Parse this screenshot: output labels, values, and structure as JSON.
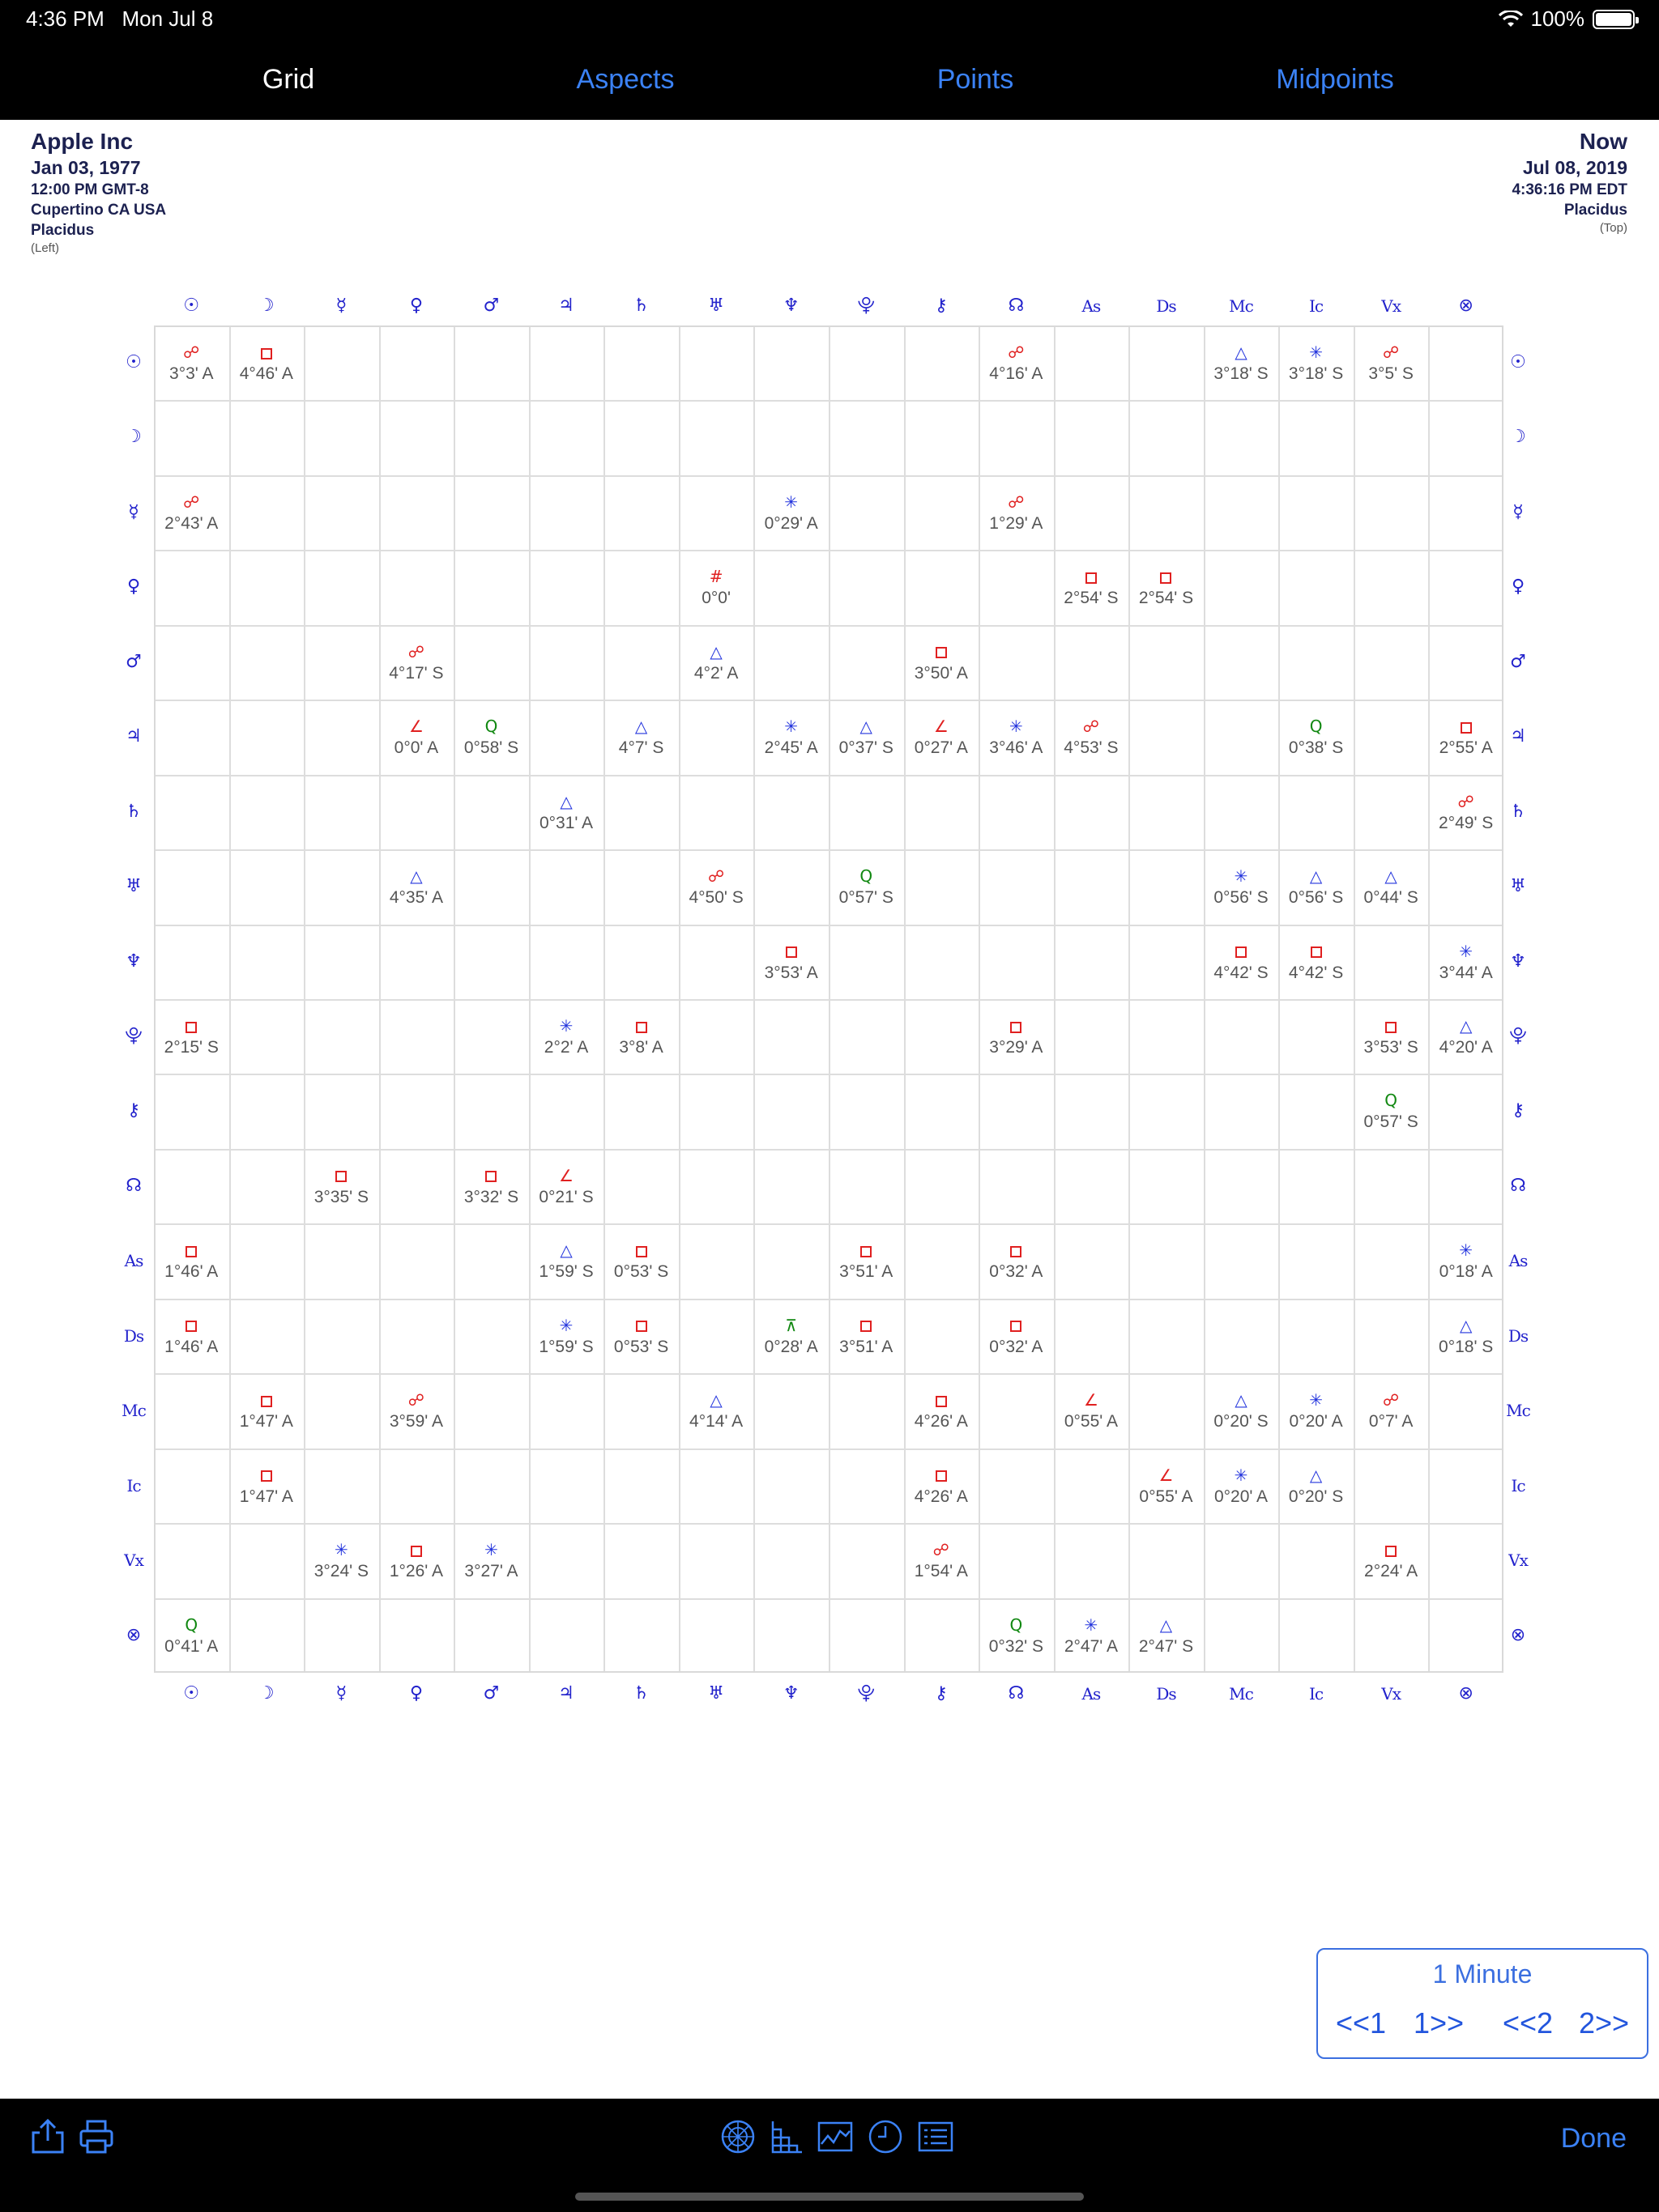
{
  "status": {
    "time": "4:36 PM",
    "date": "Mon Jul 8",
    "battery": "100%"
  },
  "tabs": [
    {
      "label": "Grid",
      "active": true
    },
    {
      "label": "Aspects",
      "active": false
    },
    {
      "label": "Points",
      "active": false
    },
    {
      "label": "Midpoints",
      "active": false
    }
  ],
  "left_chart": {
    "name": "Apple Inc",
    "date": "Jan 03, 1977",
    "time": "12:00 PM GMT-8",
    "place": "Cupertino CA USA",
    "house": "Placidus",
    "position": "(Left)"
  },
  "right_chart": {
    "name": "Now",
    "date": "Jul 08, 2019",
    "time": "4:36:16 PM EDT",
    "house": "Placidus",
    "position": "(Top)"
  },
  "points": [
    "☉",
    "☽",
    "☿",
    "♀",
    "♂",
    "♃",
    "♄",
    "♅",
    "♆",
    "⯓",
    "⚷",
    "☊",
    "As",
    "Ds",
    "Mc",
    "Ic",
    "Vx",
    "⊗"
  ],
  "point_names": [
    "sun",
    "moon",
    "mercury",
    "venus",
    "mars",
    "jupiter",
    "saturn",
    "uranus",
    "neptune",
    "pluto",
    "chiron",
    "node",
    "ascendant",
    "descendant",
    "midheaven",
    "imum-coeli",
    "vertex",
    "part-of-fortune"
  ],
  "aspect_styles": {
    "opp": {
      "glyph": "☍",
      "color": "#e02020"
    },
    "sq": {
      "glyph": "□",
      "color": "#e02020"
    },
    "tri": {
      "glyph": "△",
      "color": "#2233dd"
    },
    "sex": {
      "glyph": "✳",
      "color": "#2233dd"
    },
    "semi": {
      "glyph": "∠",
      "color": "#e02020"
    },
    "par": {
      "glyph": "#",
      "color": "#e02020"
    },
    "q": {
      "glyph": "Q",
      "color": "#118811"
    },
    "inc": {
      "glyph": "⊼",
      "color": "#118811"
    }
  },
  "aspects": [
    {
      "r": 0,
      "c": 0,
      "t": "opp",
      "o": "3°3' A"
    },
    {
      "r": 0,
      "c": 1,
      "t": "sq",
      "o": "4°46' A"
    },
    {
      "r": 0,
      "c": 11,
      "t": "opp",
      "o": "4°16' A"
    },
    {
      "r": 0,
      "c": 14,
      "t": "tri",
      "o": "3°18' S"
    },
    {
      "r": 0,
      "c": 15,
      "t": "sex",
      "o": "3°18' S"
    },
    {
      "r": 0,
      "c": 16,
      "t": "opp",
      "o": "3°5' S"
    },
    {
      "r": 2,
      "c": 0,
      "t": "opp",
      "o": "2°43' A"
    },
    {
      "r": 2,
      "c": 8,
      "t": "sex",
      "o": "0°29' A"
    },
    {
      "r": 2,
      "c": 11,
      "t": "opp",
      "o": "1°29' A"
    },
    {
      "r": 3,
      "c": 7,
      "t": "par",
      "o": "0°0'"
    },
    {
      "r": 3,
      "c": 12,
      "t": "sq",
      "o": "2°54' S"
    },
    {
      "r": 3,
      "c": 13,
      "t": "sq",
      "o": "2°54' S"
    },
    {
      "r": 4,
      "c": 3,
      "t": "opp",
      "o": "4°17' S"
    },
    {
      "r": 4,
      "c": 7,
      "t": "tri",
      "o": "4°2' A"
    },
    {
      "r": 4,
      "c": 10,
      "t": "sq",
      "o": "3°50' A"
    },
    {
      "r": 5,
      "c": 3,
      "t": "semi",
      "o": "0°0' A"
    },
    {
      "r": 5,
      "c": 4,
      "t": "q",
      "o": "0°58' S"
    },
    {
      "r": 5,
      "c": 6,
      "t": "tri",
      "o": "4°7' S"
    },
    {
      "r": 5,
      "c": 8,
      "t": "sex",
      "o": "2°45' A"
    },
    {
      "r": 5,
      "c": 9,
      "t": "tri",
      "o": "0°37' S"
    },
    {
      "r": 5,
      "c": 10,
      "t": "semi",
      "o": "0°27' A"
    },
    {
      "r": 5,
      "c": 11,
      "t": "sex",
      "o": "3°46' A"
    },
    {
      "r": 5,
      "c": 12,
      "t": "opp",
      "o": "4°53' S"
    },
    {
      "r": 5,
      "c": 15,
      "t": "q",
      "o": "0°38' S"
    },
    {
      "r": 5,
      "c": 17,
      "t": "sq",
      "o": "2°55' A"
    },
    {
      "r": 6,
      "c": 5,
      "t": "tri",
      "o": "0°31' A"
    },
    {
      "r": 6,
      "c": 17,
      "t": "opp",
      "o": "2°49' S"
    },
    {
      "r": 7,
      "c": 3,
      "t": "tri",
      "o": "4°35' A"
    },
    {
      "r": 7,
      "c": 7,
      "t": "opp",
      "o": "4°50' S"
    },
    {
      "r": 7,
      "c": 9,
      "t": "q",
      "o": "0°57' S"
    },
    {
      "r": 7,
      "c": 14,
      "t": "sex",
      "o": "0°56' S"
    },
    {
      "r": 7,
      "c": 15,
      "t": "tri",
      "o": "0°56' S"
    },
    {
      "r": 7,
      "c": 16,
      "t": "tri",
      "o": "0°44' S"
    },
    {
      "r": 8,
      "c": 8,
      "t": "sq",
      "o": "3°53' A"
    },
    {
      "r": 8,
      "c": 14,
      "t": "sq",
      "o": "4°42' S"
    },
    {
      "r": 8,
      "c": 15,
      "t": "sq",
      "o": "4°42' S"
    },
    {
      "r": 8,
      "c": 17,
      "t": "sex",
      "o": "3°44' A"
    },
    {
      "r": 9,
      "c": 0,
      "t": "sq",
      "o": "2°15' S"
    },
    {
      "r": 9,
      "c": 5,
      "t": "sex",
      "o": "2°2' A"
    },
    {
      "r": 9,
      "c": 6,
      "t": "sq",
      "o": "3°8' A"
    },
    {
      "r": 9,
      "c": 11,
      "t": "sq",
      "o": "3°29' A"
    },
    {
      "r": 9,
      "c": 16,
      "t": "sq",
      "o": "3°53' S"
    },
    {
      "r": 9,
      "c": 17,
      "t": "tri",
      "o": "4°20' A"
    },
    {
      "r": 10,
      "c": 16,
      "t": "q",
      "o": "0°57' S"
    },
    {
      "r": 11,
      "c": 2,
      "t": "sq",
      "o": "3°35' S"
    },
    {
      "r": 11,
      "c": 4,
      "t": "sq",
      "o": "3°32' S"
    },
    {
      "r": 11,
      "c": 5,
      "t": "semi",
      "o": "0°21' S"
    },
    {
      "r": 12,
      "c": 0,
      "t": "sq",
      "o": "1°46' A"
    },
    {
      "r": 12,
      "c": 5,
      "t": "tri",
      "o": "1°59' S"
    },
    {
      "r": 12,
      "c": 6,
      "t": "sq",
      "o": "0°53' S"
    },
    {
      "r": 12,
      "c": 9,
      "t": "sq",
      "o": "3°51' A"
    },
    {
      "r": 12,
      "c": 11,
      "t": "sq",
      "o": "0°32' A"
    },
    {
      "r": 12,
      "c": 17,
      "t": "sex",
      "o": "0°18' A"
    },
    {
      "r": 13,
      "c": 0,
      "t": "sq",
      "o": "1°46' A"
    },
    {
      "r": 13,
      "c": 5,
      "t": "sex",
      "o": "1°59' S"
    },
    {
      "r": 13,
      "c": 6,
      "t": "sq",
      "o": "0°53' S"
    },
    {
      "r": 13,
      "c": 8,
      "t": "inc",
      "o": "0°28' A"
    },
    {
      "r": 13,
      "c": 9,
      "t": "sq",
      "o": "3°51' A"
    },
    {
      "r": 13,
      "c": 11,
      "t": "sq",
      "o": "0°32' A"
    },
    {
      "r": 13,
      "c": 17,
      "t": "tri",
      "o": "0°18' S"
    },
    {
      "r": 14,
      "c": 1,
      "t": "sq",
      "o": "1°47' A"
    },
    {
      "r": 14,
      "c": 3,
      "t": "opp",
      "o": "3°59' A"
    },
    {
      "r": 14,
      "c": 7,
      "t": "tri",
      "o": "4°14' A"
    },
    {
      "r": 14,
      "c": 10,
      "t": "sq",
      "o": "4°26' A"
    },
    {
      "r": 14,
      "c": 12,
      "t": "semi",
      "o": "0°55' A"
    },
    {
      "r": 14,
      "c": 14,
      "t": "tri",
      "o": "0°20' S"
    },
    {
      "r": 14,
      "c": 15,
      "t": "sex",
      "o": "0°20' A"
    },
    {
      "r": 14,
      "c": 16,
      "t": "opp",
      "o": "0°7' A"
    },
    {
      "r": 15,
      "c": 1,
      "t": "sq",
      "o": "1°47' A"
    },
    {
      "r": 15,
      "c": 10,
      "t": "sq",
      "o": "4°26' A"
    },
    {
      "r": 15,
      "c": 13,
      "t": "semi",
      "o": "0°55' A"
    },
    {
      "r": 15,
      "c": 14,
      "t": "sex",
      "o": "0°20' A"
    },
    {
      "r": 15,
      "c": 15,
      "t": "tri",
      "o": "0°20' S"
    },
    {
      "r": 16,
      "c": 2,
      "t": "sex",
      "o": "3°24' S"
    },
    {
      "r": 16,
      "c": 3,
      "t": "sq",
      "o": "1°26' A"
    },
    {
      "r": 16,
      "c": 4,
      "t": "sex",
      "o": "3°27' A"
    },
    {
      "r": 16,
      "c": 10,
      "t": "opp",
      "o": "1°54' A"
    },
    {
      "r": 16,
      "c": 16,
      "t": "sq",
      "o": "2°24' A"
    },
    {
      "r": 17,
      "c": 0,
      "t": "q",
      "o": "0°41' A"
    },
    {
      "r": 17,
      "c": 11,
      "t": "q",
      "o": "0°32' S"
    },
    {
      "r": 17,
      "c": 12,
      "t": "sex",
      "o": "2°47' A"
    },
    {
      "r": 17,
      "c": 13,
      "t": "tri",
      "o": "2°47' S"
    }
  ],
  "time_control": {
    "step": "1 Minute",
    "back1": "<<1",
    "fwd1": "1>>",
    "back2": "<<2",
    "fwd2": "2>>"
  },
  "bottom_bar": {
    "done": "Done"
  }
}
